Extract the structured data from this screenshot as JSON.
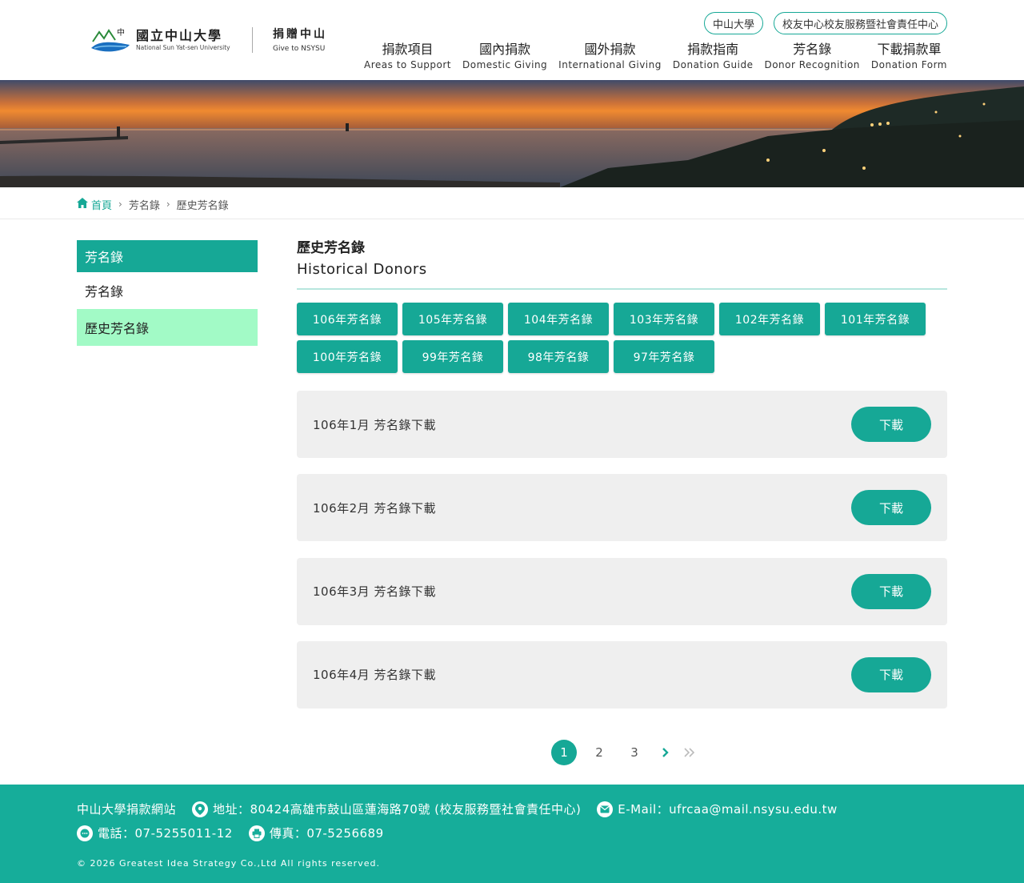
{
  "header": {
    "logo_cn": "國立中山大學",
    "logo_en": "National Sun Yat-sen University",
    "give_cn": "捐贈中山",
    "give_en": "Give to NSYSU",
    "top_links": [
      "中山大學",
      "校友中心校友服務暨社會責任中心"
    ],
    "nav": [
      {
        "cn": "捐款項目",
        "en": "Areas to Support"
      },
      {
        "cn": "國內捐款",
        "en": "Domestic Giving"
      },
      {
        "cn": "國外捐款",
        "en": "International Giving"
      },
      {
        "cn": "捐款指南",
        "en": "Donation Guide"
      },
      {
        "cn": "芳名錄",
        "en": "Donor Recognition"
      },
      {
        "cn": "下載捐款單",
        "en": "Donation Form"
      }
    ]
  },
  "breadcrumb": {
    "home": "首頁",
    "level1": "芳名錄",
    "level2": "歷史芳名錄"
  },
  "sidebar": {
    "heading": "芳名錄",
    "items": [
      "芳名錄",
      "歷史芳名錄"
    ],
    "active_index": 1
  },
  "main": {
    "title_cn": "歷史芳名錄",
    "title_en": "Historical Donors",
    "years": [
      "106年芳名錄",
      "105年芳名錄",
      "104年芳名錄",
      "103年芳名錄",
      "102年芳名錄",
      "101年芳名錄",
      "100年芳名錄",
      "99年芳名錄",
      "98年芳名錄",
      "97年芳名錄"
    ],
    "rows": [
      {
        "label": "106年1月 芳名錄下載",
        "button": "下載"
      },
      {
        "label": "106年2月 芳名錄下載",
        "button": "下載"
      },
      {
        "label": "106年3月 芳名錄下載",
        "button": "下載"
      },
      {
        "label": "106年4月 芳名錄下載",
        "button": "下載"
      }
    ]
  },
  "pagination": {
    "pages": [
      "1",
      "2",
      "3"
    ],
    "current": "1"
  },
  "footer": {
    "site": "中山大學捐款網站",
    "address": "地址：80424高雄市鼓山區蓮海路70號 (校友服務暨社會責任中心)",
    "email": "E-Mail：ufrcaa@mail.nsysu.edu.tw",
    "phone": "電話：07-5255011-12",
    "fax": "傳真：07-5256689",
    "copyright": "© 2026 Greatest Idea Strategy Co.,Ltd All rights reserved."
  },
  "colors": {
    "accent": "#16a896",
    "sidebar_active": "#a2fac6",
    "footer": "#16ad9a"
  }
}
